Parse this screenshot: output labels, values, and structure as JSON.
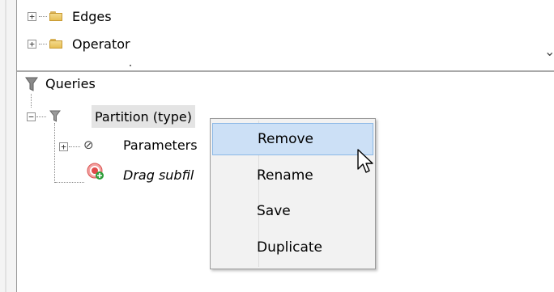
{
  "top_tree": {
    "items": [
      {
        "label": "Edges",
        "icon": "folder-icon",
        "expander": "+"
      },
      {
        "label": "Operator",
        "icon": "folder-icon",
        "expander": "+"
      }
    ],
    "scroll_indicator": "⌄"
  },
  "queries_tree": {
    "root": {
      "label": "Queries",
      "icon": "funnel-icon"
    },
    "partition": {
      "label": "Partition (type)",
      "icon": "funnel-icon",
      "expander": "−"
    },
    "children": [
      {
        "label": "Parameters",
        "icon": "link-icon",
        "expander": "+"
      },
      {
        "label": "Drag subfil",
        "icon": "target-add-icon"
      }
    ]
  },
  "context_menu": {
    "items": [
      {
        "label": "Remove",
        "hovered": true
      },
      {
        "label": "Rename",
        "hovered": false
      },
      {
        "label": "Save",
        "hovered": false
      },
      {
        "label": "Duplicate",
        "hovered": false
      }
    ]
  },
  "colors": {
    "hover_bg": "#cce0f6",
    "hover_border": "#8bb8e6",
    "selection_bg": "#e4e4e4",
    "menu_bg": "#f2f2f2"
  }
}
